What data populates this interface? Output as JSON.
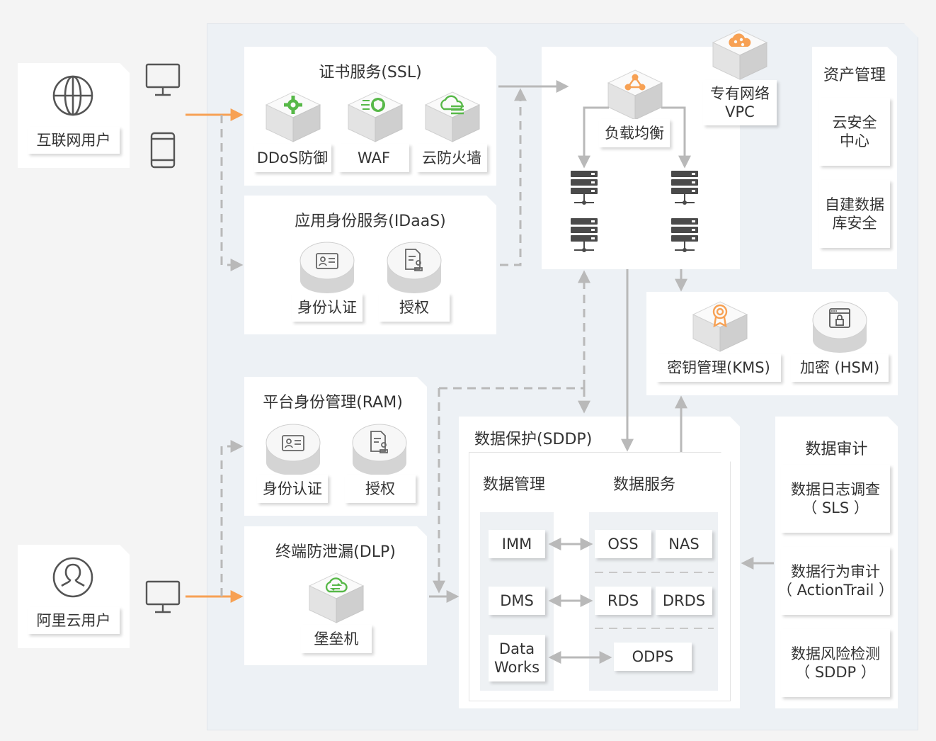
{
  "colors": {
    "accent_orange": "#f7a154",
    "icon_green": "#57b848",
    "arrow_gray": "#b9b9b9",
    "panel_bg": "#ffffff",
    "region_bg": "#edf1f5"
  },
  "users": {
    "internet": {
      "label": "互联网用户",
      "icon": "globe-icon"
    },
    "aliyun": {
      "label": "阿里云用户",
      "icon": "user-icon"
    }
  },
  "ssl": {
    "title": "证书服务(SSL)",
    "items": [
      {
        "label": "DDoS防御",
        "icon": "gear-cube-icon"
      },
      {
        "label": "WAF",
        "icon": "shield-cube-icon"
      },
      {
        "label": "云防火墙",
        "icon": "cloud-firewall-cube-icon"
      }
    ]
  },
  "idaas": {
    "title": "应用身份服务(IDaaS)",
    "items": [
      {
        "label": "身份认证",
        "icon": "id-card-icon"
      },
      {
        "label": "授权",
        "icon": "document-stamp-icon"
      }
    ]
  },
  "ram": {
    "title": "平台身份管理(RAM)",
    "items": [
      {
        "label": "身份认证",
        "icon": "id-card-icon"
      },
      {
        "label": "授权",
        "icon": "document-stamp-icon"
      }
    ]
  },
  "dlp": {
    "title": "终端防泄漏(DLP)",
    "items": [
      {
        "label": "堡垒机",
        "icon": "bastion-cube-icon"
      }
    ]
  },
  "vpc": {
    "label": "专有网络\nVPC",
    "load_balancer": "负载均衡"
  },
  "asset": {
    "title": "资产管理",
    "items": [
      "云安全\n中心",
      "自建数据\n库安全"
    ]
  },
  "kms": {
    "items": [
      {
        "label": "密钥管理(KMS)",
        "icon": "key-cube-icon"
      },
      {
        "label": "加密 (HSM)",
        "icon": "lock-window-icon"
      }
    ]
  },
  "sddp": {
    "title": "数据保护(SDDP)",
    "mgmt_title": "数据管理",
    "svc_title": "数据服务",
    "mgmt_items": [
      "IMM",
      "DMS",
      "Data\nWorks"
    ],
    "svc_items": [
      "OSS",
      "NAS",
      "RDS",
      "DRDS",
      "ODPS"
    ]
  },
  "audit": {
    "title": "数据审计",
    "items": [
      "数据日志调查\n（ SLS ）",
      "数据行为审计\n（ ActionTrail ）",
      "数据风险检测\n（ SDDP ）"
    ]
  }
}
